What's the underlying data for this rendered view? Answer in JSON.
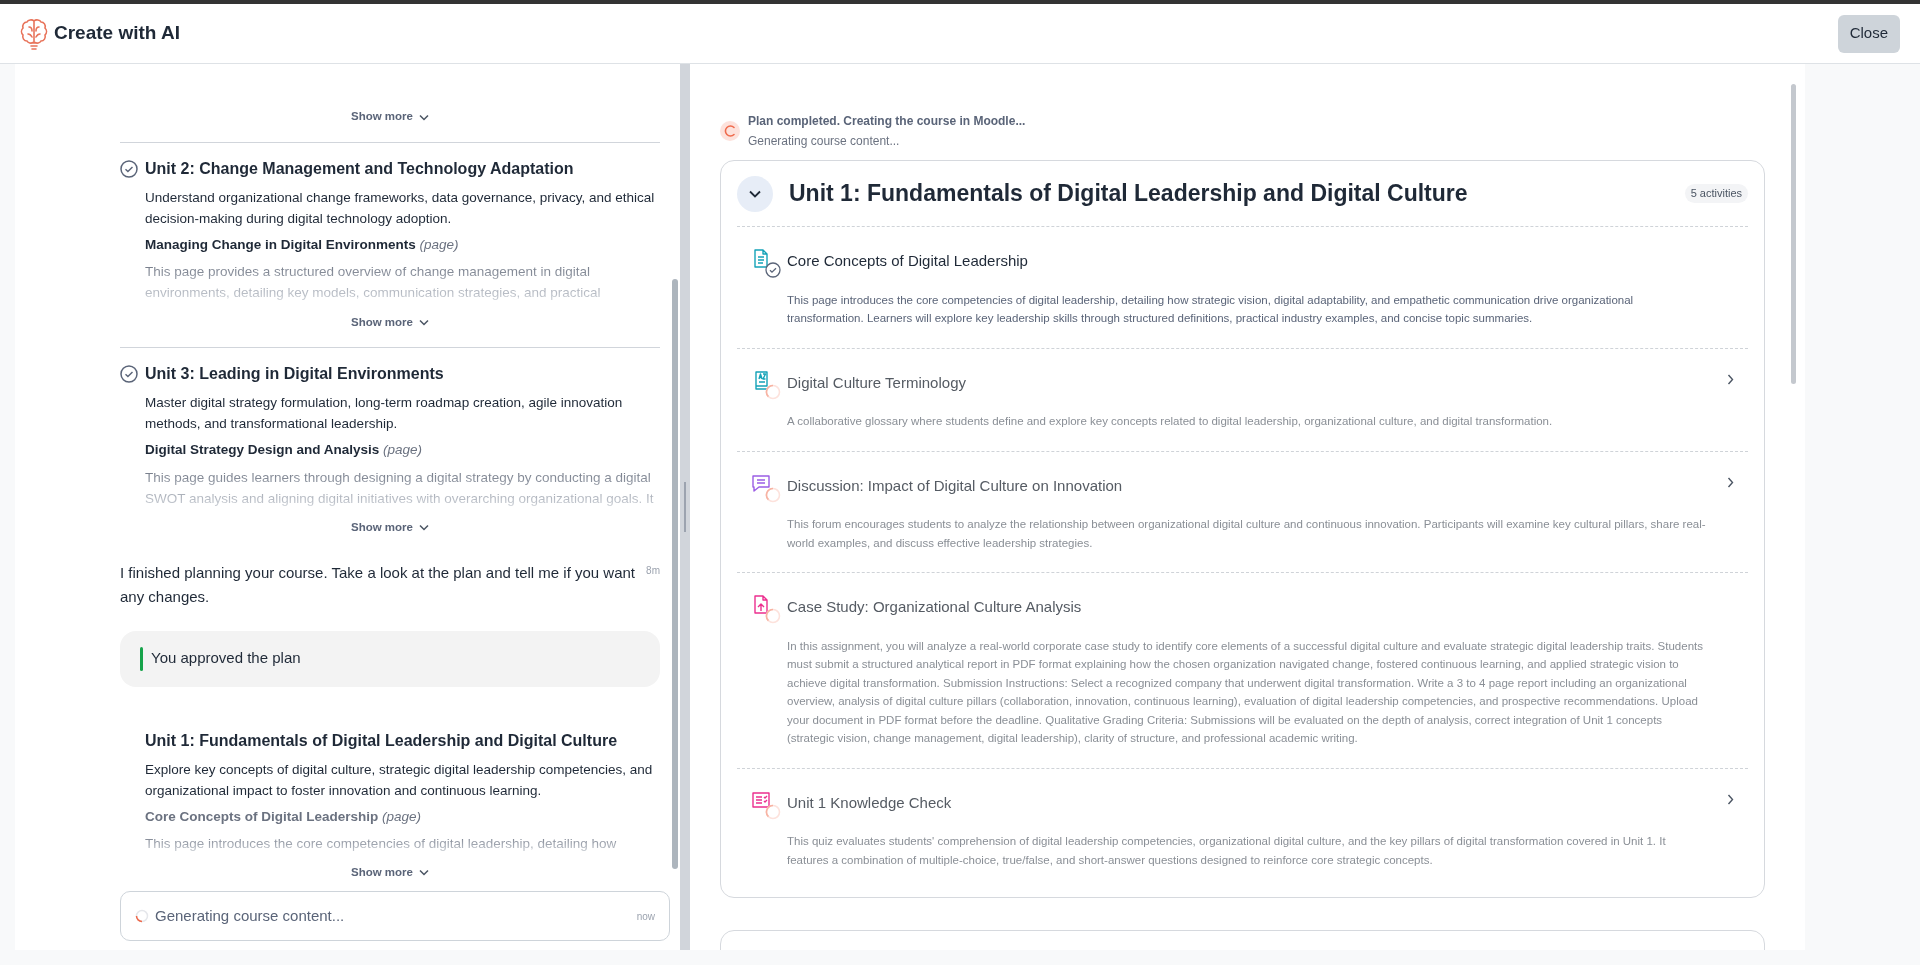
{
  "header": {
    "title": "Create with AI",
    "close_button": "Close"
  },
  "chat": {
    "top_show_more": "Show more",
    "units": [
      {
        "title": "Unit 2: Change Management and Technology Adaptation",
        "completed": true,
        "description": "Understand organizational change frameworks, data governance, privacy, and ethical decision-making during digital technology adoption.",
        "activity_title": "Managing Change in Digital Environments",
        "activity_type": "(page)",
        "preview": "This page provides a structured overview of change management in digital environments, detailing key models, communication strategies, and practical",
        "show_more": "Show more"
      },
      {
        "title": "Unit 3: Leading in Digital Environments",
        "completed": true,
        "description": "Master digital strategy formulation, long-term roadmap creation, agile innovation methods, and transformational leadership.",
        "activity_title": "Digital Strategy Design and Analysis",
        "activity_type": "(page)",
        "preview": "This page guides learners through designing a digital strategy by conducting a digital SWOT analysis and aligning digital initiatives with overarching organizational goals. It",
        "show_more": "Show more"
      }
    ],
    "message": {
      "text": "I finished planning your course. Take a look at the plan and tell me if you want any changes.",
      "time": "8m"
    },
    "approval": "You approved the plan",
    "plan_unit": {
      "title": "Unit 1: Fundamentals of Digital Leadership and Digital Culture",
      "completed": false,
      "description": "Explore key concepts of digital culture, strategic digital leadership competencies, and organizational impact to foster innovation and continuous learning.",
      "activity_title": "Core Concepts of Digital Leadership",
      "activity_type": "(page)",
      "preview": "This page introduces the core competencies of digital leadership, detailing how",
      "show_more": "Show more"
    },
    "status_field": {
      "text": "Generating course content...",
      "time": "now"
    }
  },
  "progress": {
    "title": "Plan completed. Creating the course in Moodle...",
    "subtitle": "Generating course content..."
  },
  "course_unit": {
    "title": "Unit 1: Fundamentals of Digital Leadership and Digital Culture",
    "expanded": true,
    "badge": "5 activities",
    "activities": [
      {
        "kind": "page",
        "done": true,
        "expandable": false,
        "title": "Core Concepts of Digital Leadership",
        "description": "This page introduces the core competencies of digital leadership, detailing how strategic vision, digital adaptability, and empathetic communication drive organizational transformation. Learners will explore key leadership skills through structured definitions, practical industry examples, and concise topic summaries."
      },
      {
        "kind": "glossary",
        "done": false,
        "expandable": true,
        "title": "Digital Culture Terminology",
        "description": "A collaborative glossary where students define and explore key concepts related to digital leadership, organizational culture, and digital transformation."
      },
      {
        "kind": "forum",
        "done": false,
        "expandable": true,
        "title": "Discussion: Impact of Digital Culture on Innovation",
        "description": "This forum encourages students to analyze the relationship between organizational digital culture and continuous innovation. Participants will examine key cultural pillars, share real-world examples, and discuss effective leadership strategies."
      },
      {
        "kind": "assignment",
        "done": false,
        "expandable": false,
        "title": "Case Study: Organizational Culture Analysis",
        "description": "In this assignment, you will analyze a real-world corporate case study to identify core elements of a successful digital culture and evaluate strategic digital leadership traits. Students must submit a structured analytical report in PDF format explaining how the chosen organization navigated change, fostered continuous learning, and applied strategic vision to achieve digital transformation. Submission Instructions: Select a recognized company that underwent digital transformation. Write a 3 to 4 page report including an organizational overview, analysis of digital culture pillars (collaboration, innovation, continuous learning), evaluation of digital leadership competencies, and prospective recommendations. Upload your document in PDF format before the deadline. Qualitative Grading Criteria: Submissions will be evaluated on the depth of analysis, correct integration of Unit 1 concepts (strategic vision, change management, digital leadership), clarity of structure, and professional academic writing."
      },
      {
        "kind": "quiz",
        "done": false,
        "expandable": true,
        "title": "Unit 1 Knowledge Check",
        "description": "This quiz evaluates students' comprehension of digital leadership competencies, organizational digital culture, and the key pillars of digital transformation covered in Unit 1. It features a combination of multiple-choice, true/false, and short-answer questions designed to reinforce core strategic concepts."
      }
    ]
  }
}
